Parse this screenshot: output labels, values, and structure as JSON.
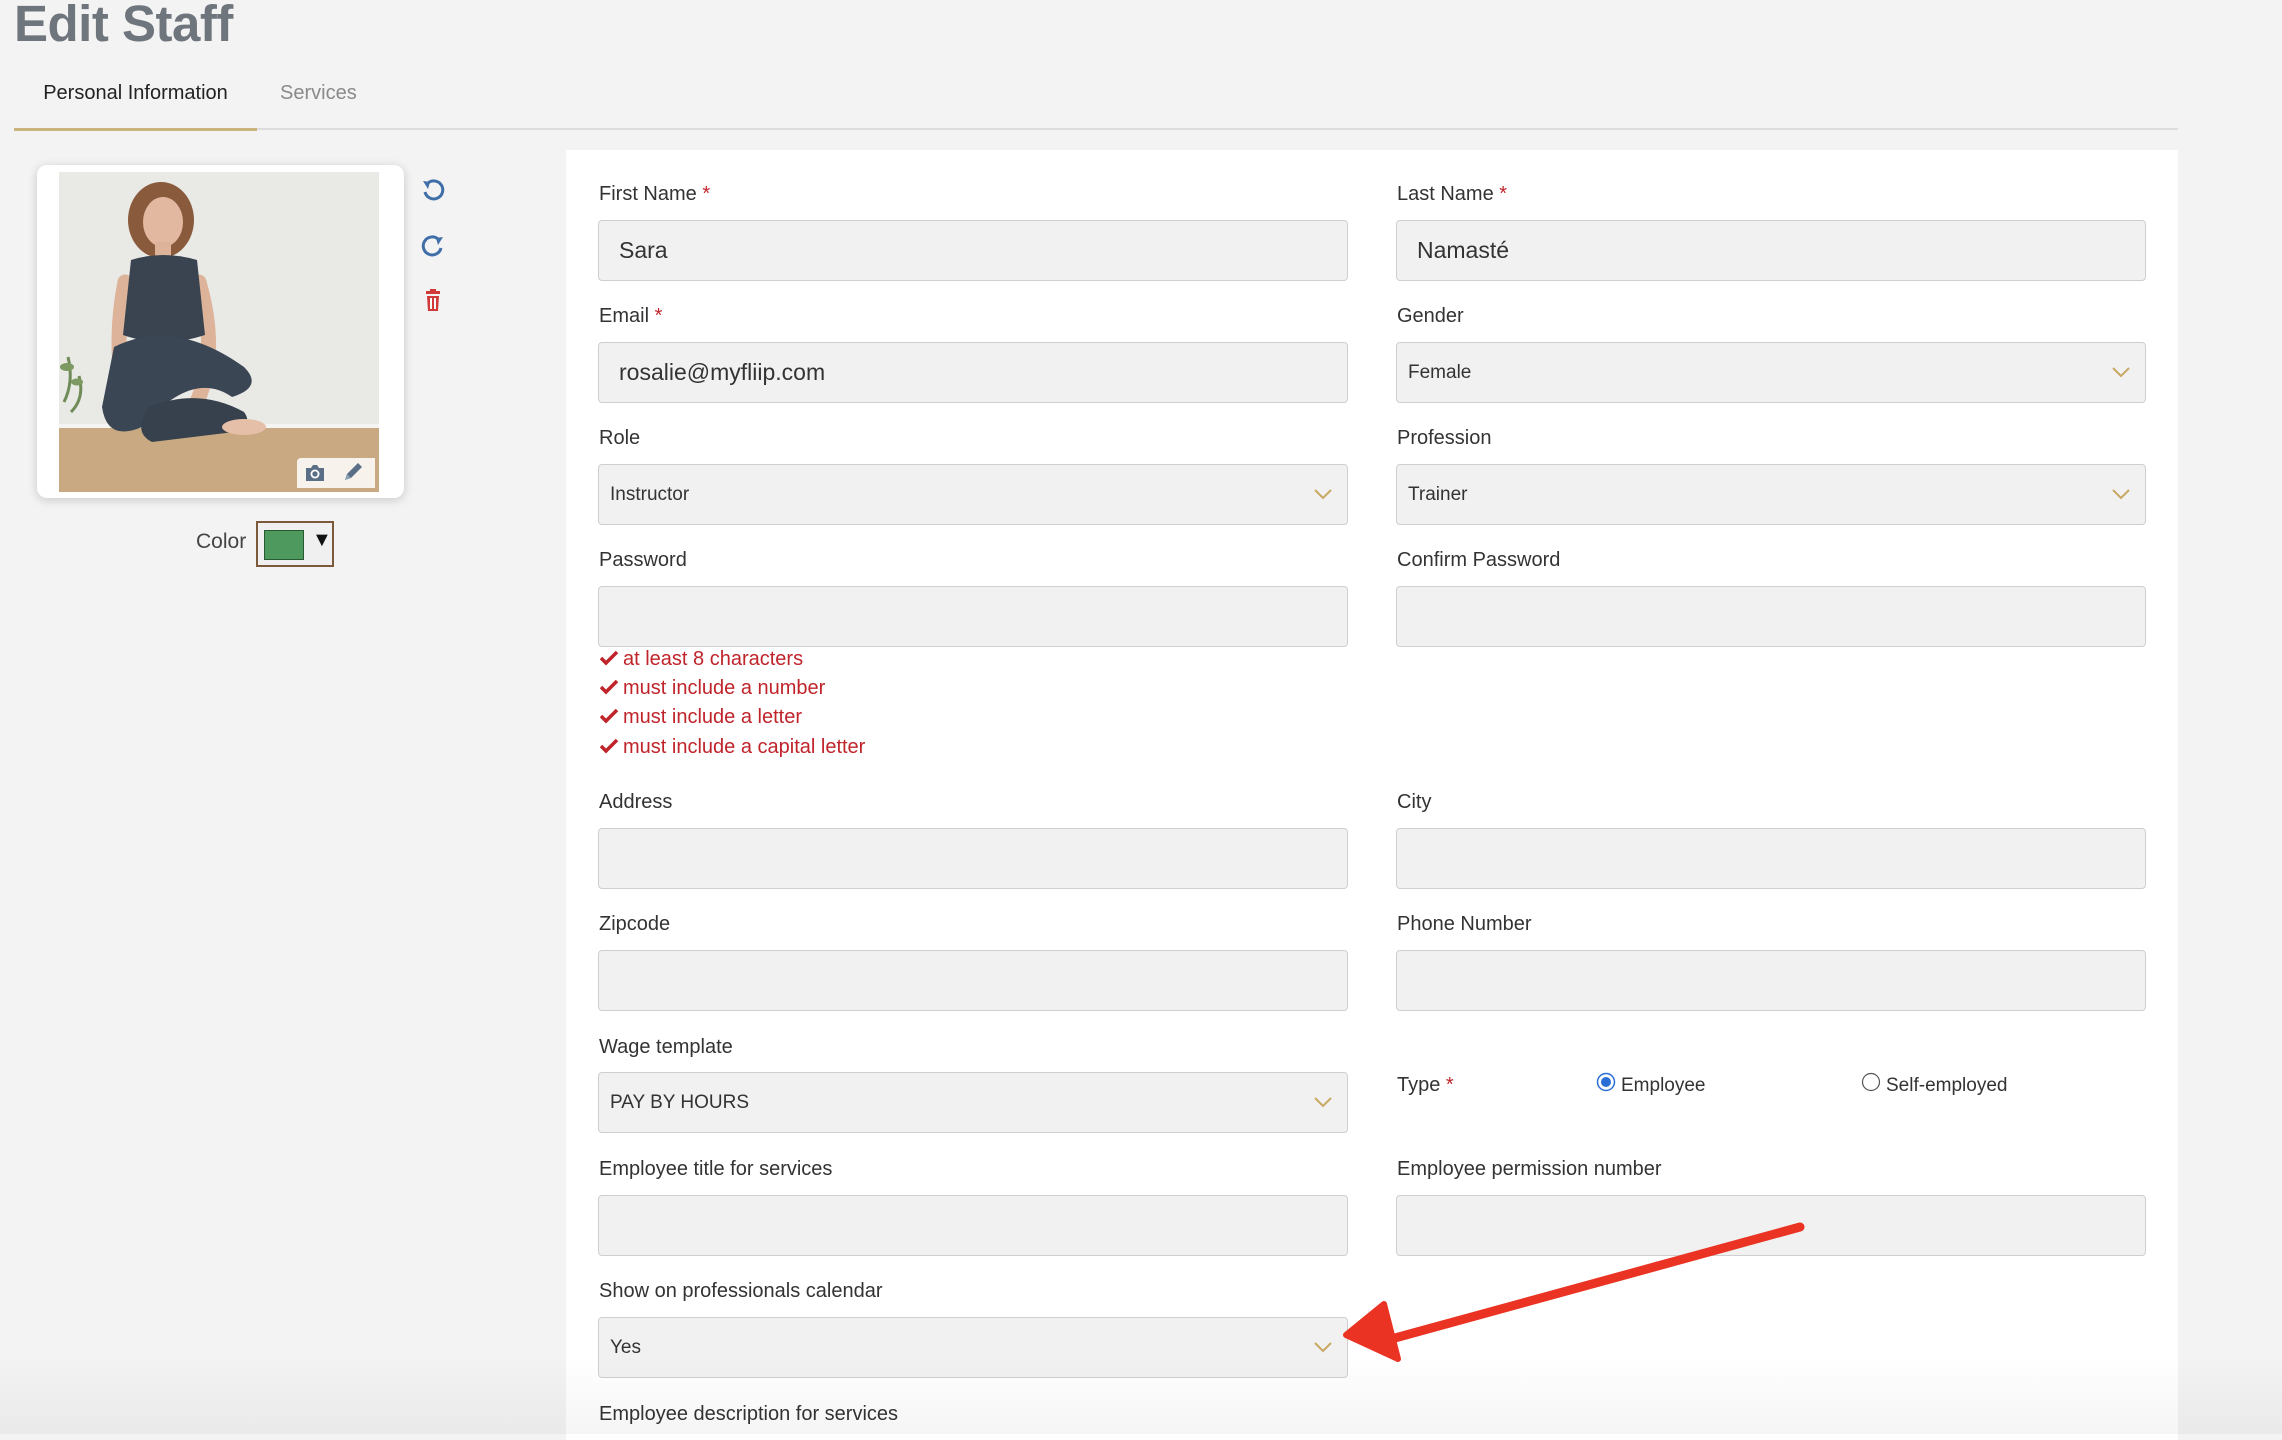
{
  "page": {
    "title": "Edit Staff"
  },
  "tabs": [
    {
      "label": "Personal Information",
      "active": true
    },
    {
      "label": "Services",
      "active": false
    }
  ],
  "profile": {
    "photo_alt": "Staff photo",
    "icons": [
      "undo-icon",
      "redo-icon",
      "trash-icon",
      "camera-icon",
      "pencil-icon"
    ],
    "color_label": "Color",
    "color_value": "#4e9a5e"
  },
  "form": {
    "first_name": {
      "label": "First Name",
      "required_mark": "*",
      "value": "Sara"
    },
    "last_name": {
      "label": "Last Name",
      "required_mark": "*",
      "value": "Namasté"
    },
    "email": {
      "label": "Email",
      "required_mark": "*",
      "value": "rosalie@myfliip.com"
    },
    "gender": {
      "label": "Gender",
      "value": "Female"
    },
    "role": {
      "label": "Role",
      "value": "Instructor"
    },
    "profession": {
      "label": "Profession",
      "value": "Trainer"
    },
    "password": {
      "label": "Password",
      "value": ""
    },
    "confirm_password": {
      "label": "Confirm Password",
      "value": ""
    },
    "password_rules": [
      "at least 8 characters",
      "must include a number",
      "must include a letter",
      "must include a capital letter"
    ],
    "address": {
      "label": "Address",
      "value": ""
    },
    "city": {
      "label": "City",
      "value": ""
    },
    "zipcode": {
      "label": "Zipcode",
      "value": ""
    },
    "phone": {
      "label": "Phone Number",
      "value": ""
    },
    "wage_template": {
      "label": "Wage template",
      "value": "PAY BY HOURS"
    },
    "type": {
      "label": "Type",
      "required_mark": "*",
      "options": [
        "Employee",
        "Self-employed"
      ],
      "selected": "Employee"
    },
    "employee_title": {
      "label": "Employee title for services",
      "value": ""
    },
    "permission_number": {
      "label": "Employee permission number",
      "value": ""
    },
    "show_on_calendar": {
      "label": "Show on professionals calendar",
      "value": "Yes"
    },
    "employee_description": {
      "label": "Employee description for services"
    }
  },
  "colors": {
    "accent_gold": "#c8b47c",
    "required_red": "#c0242b",
    "annotation_red": "#ea3323",
    "icon_blue": "#3f6ea8"
  }
}
